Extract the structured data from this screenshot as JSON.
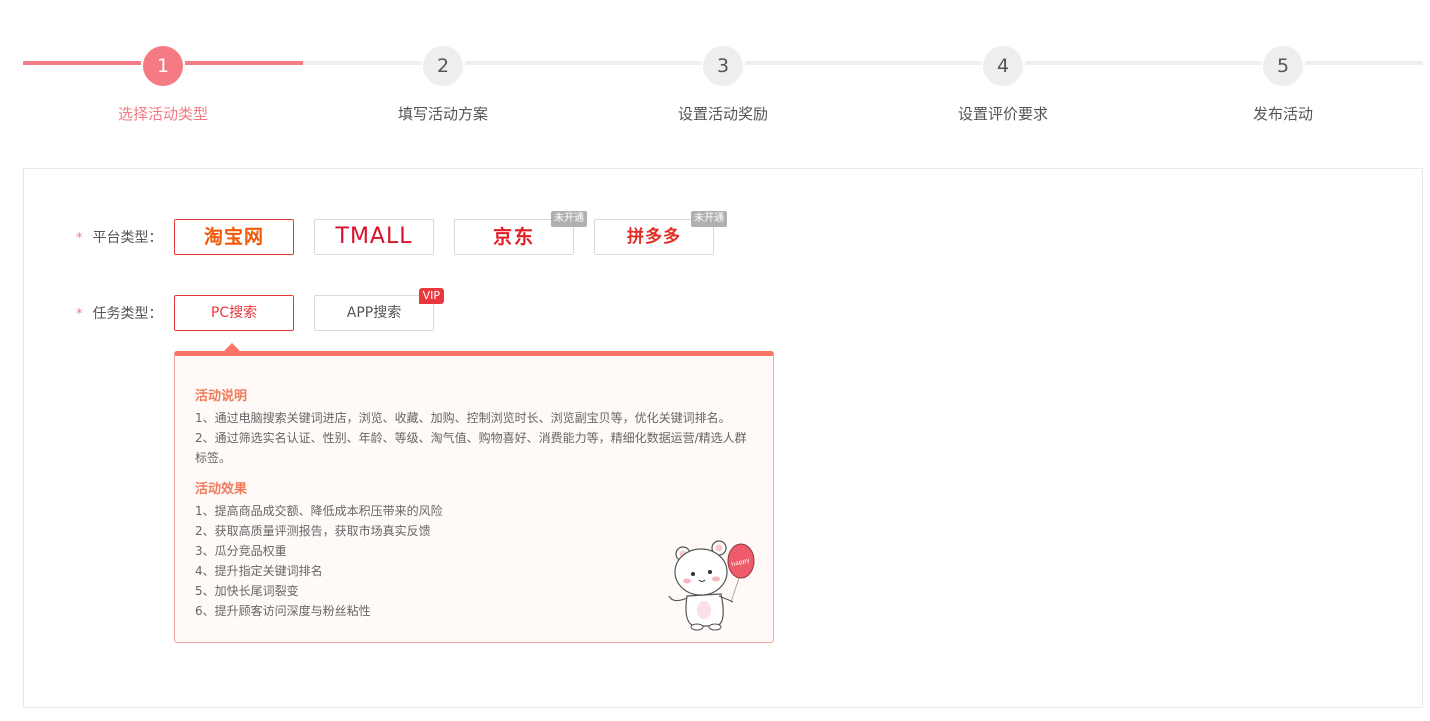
{
  "steps": [
    {
      "number": "1",
      "label": "选择活动类型",
      "active": true
    },
    {
      "number": "2",
      "label": "填写活动方案",
      "active": false
    },
    {
      "number": "3",
      "label": "设置活动奖励",
      "active": false
    },
    {
      "number": "4",
      "label": "设置评价要求",
      "active": false
    },
    {
      "number": "5",
      "label": "发布活动",
      "active": false
    }
  ],
  "platform": {
    "required_mark": "*",
    "label": "平台类型：",
    "options": [
      {
        "name": "taobao",
        "text": "淘宝网",
        "badge": ""
      },
      {
        "name": "tmall",
        "text": "TMALL",
        "badge": ""
      },
      {
        "name": "jd",
        "text": "京东",
        "badge": "未开通"
      },
      {
        "name": "pinduoduo",
        "text": "拼多多",
        "badge": "未开通"
      }
    ],
    "selected": "taobao"
  },
  "task": {
    "required_mark": "*",
    "label": "任务类型：",
    "options": [
      {
        "name": "pc-search",
        "text": "PC搜索",
        "badge": ""
      },
      {
        "name": "app-search",
        "text": "APP搜索",
        "badge": "VIP"
      }
    ],
    "selected": "pc-search"
  },
  "description": {
    "section1_title": "活动说明",
    "section1_lines": [
      "1、通过电脑搜索关键词进店，浏览、收藏、加购、控制浏览时长、浏览副宝贝等，优化关键词排名。",
      "2、通过筛选实名认证、性别、年龄、等级、淘气值、购物喜好、消费能力等，精细化数据运营/精选人群",
      "标签。"
    ],
    "section2_title": "活动效果",
    "section2_lines": [
      "1、提高商品成交额、降低成本积压带来的风险",
      "2、获取高质量评测报告，获取市场真实反馈",
      "3、瓜分竞品权重",
      "4、提升指定关键词排名",
      "5、加快长尾词裂变",
      "6、提升顾客访问深度与粉丝粘性"
    ],
    "balloon_text": "happy"
  },
  "colors": {
    "accent": "#f47a83",
    "selected_border": "#e8383d",
    "desc_top": "#fa7566",
    "desc_title": "#f07b5a"
  }
}
